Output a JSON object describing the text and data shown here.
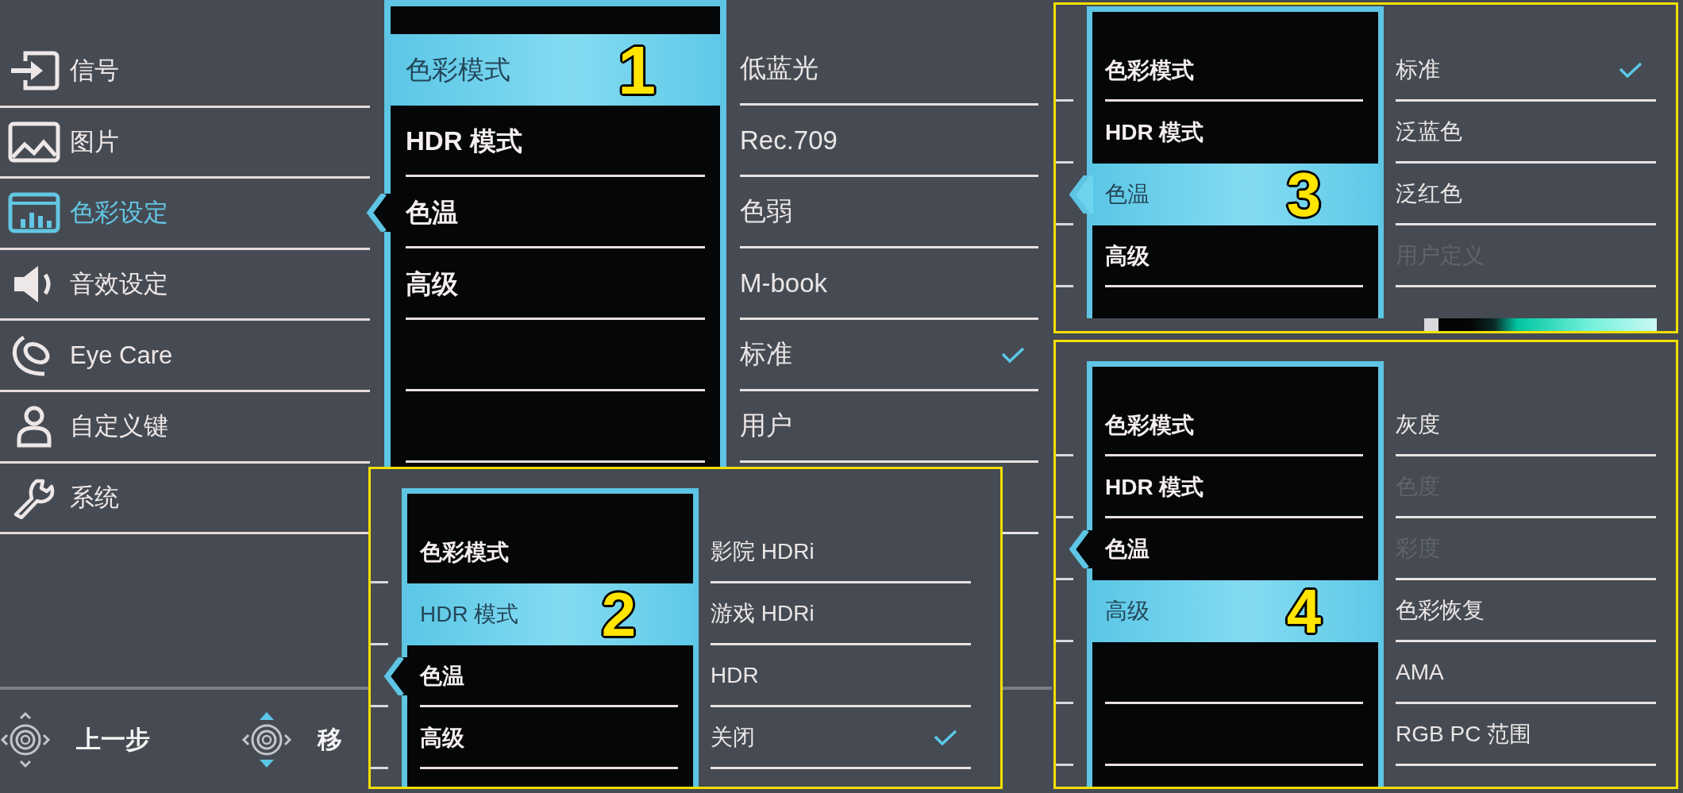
{
  "sidebar": {
    "items": [
      {
        "label": "信号",
        "selected": false
      },
      {
        "label": "图片",
        "selected": false
      },
      {
        "label": "色彩设定",
        "selected": true
      },
      {
        "label": "音效设定",
        "selected": false
      },
      {
        "label": "Eye Care",
        "selected": false
      },
      {
        "label": "自定义键",
        "selected": false
      },
      {
        "label": "系统",
        "selected": false
      }
    ]
  },
  "main_panel": {
    "callout": "1",
    "menu": [
      {
        "label": "色彩模式",
        "selected": true
      },
      {
        "label": "HDR 模式",
        "selected": false
      },
      {
        "label": "色温",
        "selected": false
      },
      {
        "label": "高级",
        "selected": false
      }
    ],
    "options": [
      {
        "label": "低蓝光",
        "checked": false,
        "disabled": false
      },
      {
        "label": "Rec.709",
        "checked": false,
        "disabled": false
      },
      {
        "label": "色弱",
        "checked": false,
        "disabled": false
      },
      {
        "label": "M-book",
        "checked": false,
        "disabled": false
      },
      {
        "label": "标准",
        "checked": true,
        "disabled": false
      },
      {
        "label": "用户",
        "checked": false,
        "disabled": false
      }
    ]
  },
  "footer": {
    "hints": [
      {
        "label": "上一步"
      },
      {
        "label": "移"
      }
    ]
  },
  "insets": [
    {
      "callout": "2",
      "menu": [
        {
          "label": "色彩模式",
          "selected": false
        },
        {
          "label": "HDR 模式",
          "selected": true
        },
        {
          "label": "色温",
          "selected": false
        },
        {
          "label": "高级",
          "selected": false
        }
      ],
      "options": [
        {
          "label": "影院 HDRi",
          "checked": false,
          "disabled": false
        },
        {
          "label": "游戏 HDRi",
          "checked": false,
          "disabled": false
        },
        {
          "label": "HDR",
          "checked": false,
          "disabled": false
        },
        {
          "label": "关闭",
          "checked": true,
          "disabled": false
        }
      ]
    },
    {
      "callout": "3",
      "menu": [
        {
          "label": "色彩模式",
          "selected": false
        },
        {
          "label": "HDR 模式",
          "selected": false
        },
        {
          "label": "色温",
          "selected": true
        },
        {
          "label": "高级",
          "selected": false
        }
      ],
      "options": [
        {
          "label": "标准",
          "checked": true,
          "disabled": false
        },
        {
          "label": "泛蓝色",
          "checked": false,
          "disabled": false
        },
        {
          "label": "泛红色",
          "checked": false,
          "disabled": false
        },
        {
          "label": "用户定义",
          "checked": false,
          "disabled": true
        }
      ]
    },
    {
      "callout": "4",
      "menu": [
        {
          "label": "色彩模式",
          "selected": false
        },
        {
          "label": "HDR 模式",
          "selected": false
        },
        {
          "label": "色温",
          "selected": false
        },
        {
          "label": "高级",
          "selected": true
        }
      ],
      "options": [
        {
          "label": "灰度",
          "checked": false,
          "disabled": false
        },
        {
          "label": "色度",
          "checked": false,
          "disabled": true
        },
        {
          "label": "彩度",
          "checked": false,
          "disabled": true
        },
        {
          "label": "色彩恢复",
          "checked": false,
          "disabled": false
        },
        {
          "label": "AMA",
          "checked": false,
          "disabled": false
        },
        {
          "label": "RGB PC 范围",
          "checked": false,
          "disabled": false
        }
      ]
    }
  ]
}
